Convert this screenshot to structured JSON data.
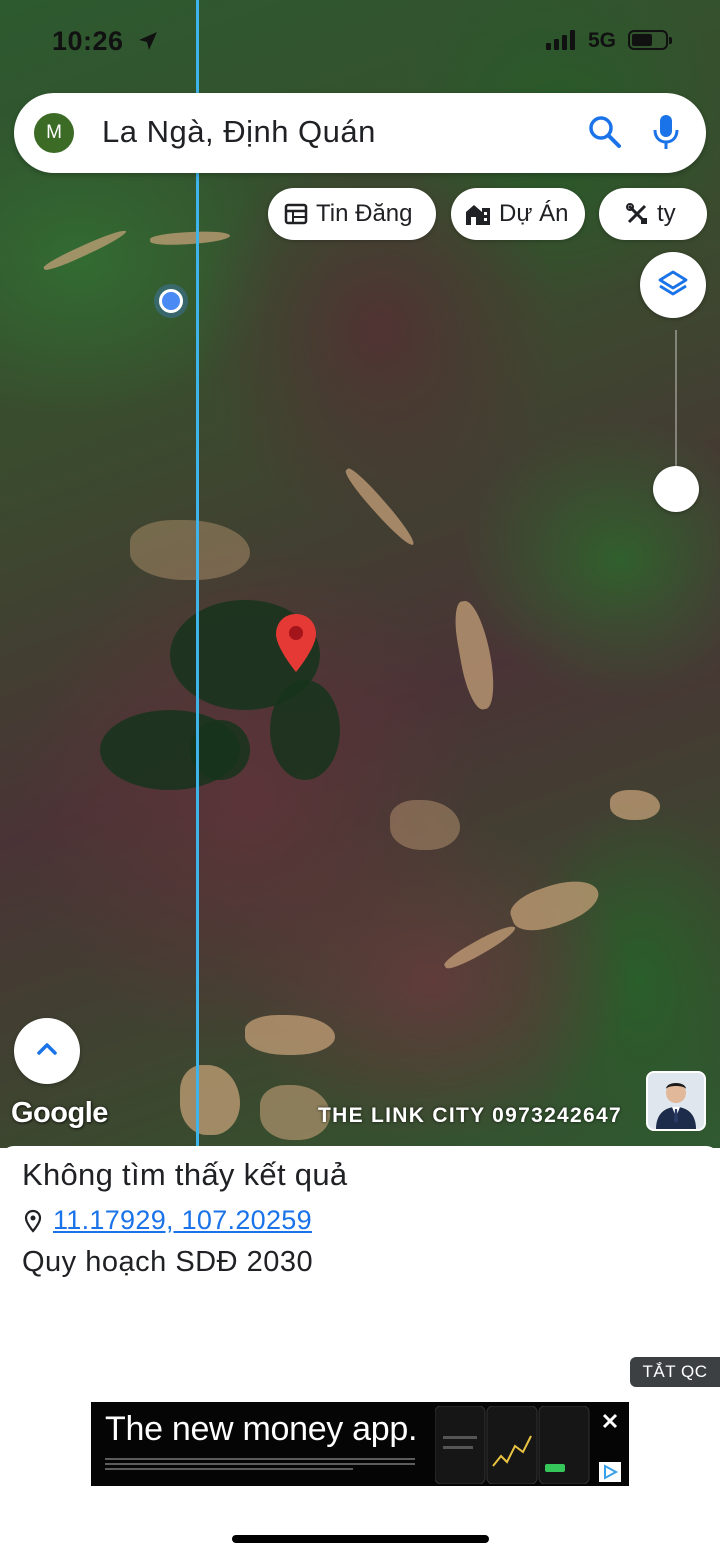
{
  "status_bar": {
    "time": "10:26",
    "network": "5G",
    "location_icon": "location-arrow-icon",
    "signal_icon": "signal-bars-icon",
    "battery_icon": "battery-icon"
  },
  "search": {
    "avatar_letter": "M",
    "query": "La Ngà, Định Quán",
    "search_icon": "search-icon",
    "mic_icon": "mic-icon"
  },
  "chips": [
    {
      "label": "Tin Đăng",
      "icon": "listing-icon"
    },
    {
      "label": "Dự Án",
      "icon": "project-building-icon"
    },
    {
      "label": "ty",
      "icon": "tools-icon"
    }
  ],
  "map": {
    "attribution": "Google",
    "watermark": "THE LINK CITY 0973242647",
    "marker_color": "#e53935",
    "user_location_color": "#4a8af4",
    "boundary_line_color": "#3fb4e8"
  },
  "result": {
    "title": "Không tìm thấy kết quả",
    "coordinates": "11.17929, 107.20259",
    "plan_label": "Quy hoạch SDĐ 2030"
  },
  "ads": {
    "hide_label": "TẮT QC",
    "headline": "The new money app."
  },
  "colors": {
    "link": "#1a73e8",
    "avatar_bg": "#3c6b25",
    "accent": "#1a73e8"
  }
}
